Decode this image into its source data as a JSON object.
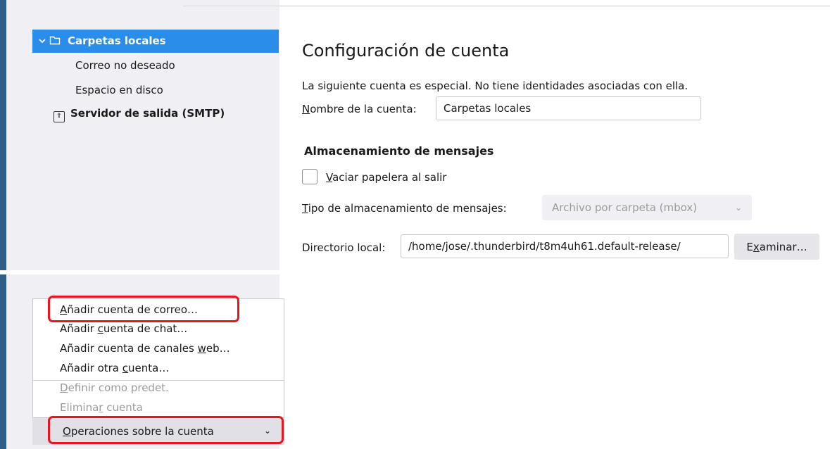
{
  "sidebar": {
    "selected": {
      "label": "Carpetas locales",
      "icon": "folder-icon",
      "expand_icon": "chevron-down-icon"
    },
    "children": [
      "Correo no deseado",
      "Espacio en disco"
    ],
    "smtp": {
      "label": "Servidor de salida (SMTP)",
      "icon": "outgoing-server-icon"
    }
  },
  "settings": {
    "title": "Configuración de cuenta",
    "description": "La siguiente cuenta es especial. No tiene identidades asociadas con ella.",
    "account_name": {
      "label_mnemonic": "N",
      "label_rest": "ombre de la cuenta:",
      "value": "Carpetas locales"
    },
    "storage_section": "Almacenamiento de mensajes",
    "empty_trash": {
      "mnemonic": "V",
      "rest": "aciar papelera al salir",
      "checked": false
    },
    "store_type": {
      "mnemonic": "T",
      "rest": "ipo de almacenamiento de mensajes:",
      "value": "Archivo por carpeta (mbox)"
    },
    "local_dir": {
      "label": "Directorio local:",
      "value": "/home/jose/.thunderbird/t8m4uh61.default-release/"
    },
    "browse": {
      "pre": "E",
      "mnemonic": "x",
      "post": "aminar…"
    }
  },
  "account_menu": {
    "items": [
      {
        "pre": "",
        "mnemonic": "A",
        "post": "ñadir cuenta de correo…",
        "disabled": false
      },
      {
        "pre": "Añadir ",
        "mnemonic": "c",
        "post": "uenta de chat…",
        "disabled": false
      },
      {
        "pre": "Añadir cuenta de canales ",
        "mnemonic": "w",
        "post": "eb…",
        "disabled": false
      },
      {
        "pre": "Añadir otra ",
        "mnemonic": "c",
        "post": "uenta…",
        "disabled": false
      },
      {
        "pre": "",
        "mnemonic": "D",
        "post": "efinir como predet.",
        "disabled": true
      },
      {
        "pre": "Elimina",
        "mnemonic": "r",
        "post": " cuenta",
        "disabled": true
      }
    ],
    "button": {
      "mnemonic": "O",
      "rest": "peraciones sobre la cuenta",
      "icon": "chevron-down-icon"
    }
  },
  "colors": {
    "selection": "#2b8dea",
    "highlight": "#e8141e"
  }
}
